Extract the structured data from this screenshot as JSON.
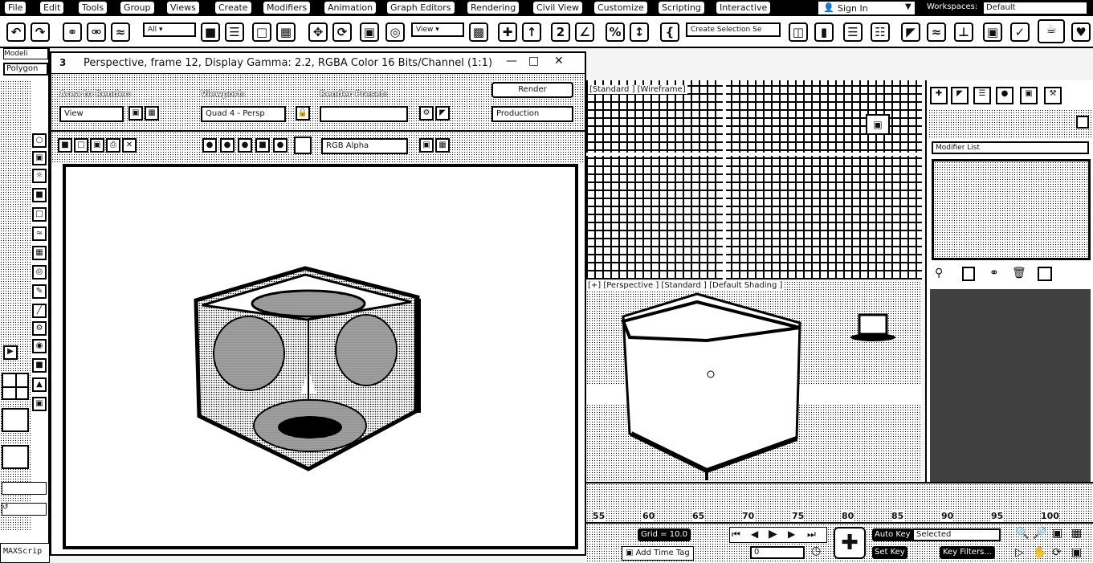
{
  "menu": [
    "File",
    "Edit",
    "Tools",
    "Group",
    "Views",
    "Create",
    "Modifiers",
    "Animation",
    "Graph Editors",
    "Rendering",
    "Civil View",
    "Customize",
    "Scripting",
    "Interactive"
  ],
  "signin": {
    "label": "Sign In"
  },
  "workspaces": {
    "label": "Workspaces:",
    "value": "Default"
  },
  "toolbar": {
    "filter_value": "All",
    "refcoord_value": "View",
    "selection_set_placeholder": "Create Selection Se"
  },
  "left_strip": {
    "field_value": "Polygon",
    "tab_label": "Modeli"
  },
  "render_window": {
    "number": "3",
    "title": "Perspective, frame 12, Display Gamma: 2.2, RGBA Color 16 Bits/Channel (1:1)",
    "area_label": "Area to Render:",
    "area_value": "View",
    "viewport_label": "Viewport:",
    "viewport_value": "Quad 4 - Persp",
    "preset_label": "Render Preset:",
    "preset_value": "",
    "render_button": "Render",
    "production_value": "Production",
    "channel_value": "RGB Alpha"
  },
  "viewport_top": {
    "label": "[Standard ] [Wireframe]"
  },
  "viewport_persp": {
    "label": "[+] [Perspective ] [Standard ] [Default Shading ]"
  },
  "command_panel": {
    "modifier_list": "Modifier List"
  },
  "timeline": {
    "ticks": [
      "55",
      "60",
      "65",
      "70",
      "75",
      "80",
      "85",
      "90",
      "95",
      "100"
    ]
  },
  "bottom": {
    "grid": "Grid = 10.0",
    "add_time_tag": "Add Time Tag",
    "frame_value": "0",
    "auto_key": "Auto Key",
    "set_key": "Set Key",
    "selected": "Selected",
    "key_filters": "Key Filters..."
  },
  "maxscript": "MAXScrip",
  "colors": {
    "ink": "#000000",
    "paper": "#ffffff"
  }
}
